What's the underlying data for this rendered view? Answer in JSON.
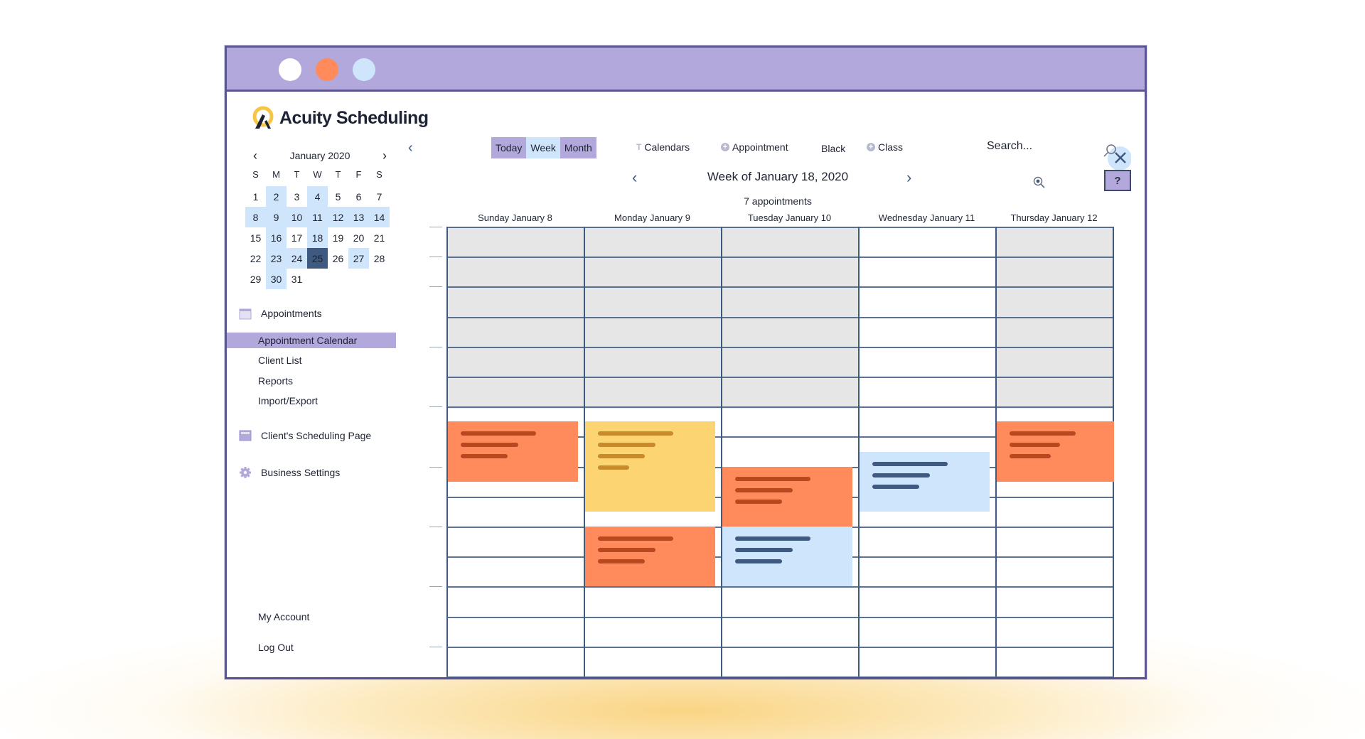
{
  "window": {
    "title_dots": [
      "white",
      "orange",
      "light-blue"
    ],
    "colors": {
      "titlebar": "#b2a8dc",
      "accent_orange": "#ff8a5b",
      "accent_yellow": "#fcd572",
      "accent_blue": "#cfe5fb",
      "selected_day": "#3e5a80"
    }
  },
  "brand": {
    "name": "Acuity Scheduling"
  },
  "mini_calendar": {
    "month_label": "January 2020",
    "weekdays": [
      "S",
      "M",
      "T",
      "W",
      "T",
      "F",
      "S"
    ],
    "weeks": [
      [
        1,
        2,
        3,
        4,
        5,
        6,
        7
      ],
      [
        8,
        9,
        10,
        11,
        12,
        13,
        14
      ],
      [
        15,
        16,
        17,
        18,
        19,
        20,
        21
      ],
      [
        22,
        23,
        24,
        25,
        26,
        27,
        28
      ],
      [
        29,
        30,
        31,
        null,
        null,
        null,
        null
      ]
    ],
    "highlighted_days": [
      2,
      4,
      8,
      9,
      10,
      11,
      12,
      13,
      14,
      16,
      18,
      23,
      24,
      27,
      30
    ],
    "selected_day": 25
  },
  "sidebar": {
    "appointments_label": "Appointments",
    "items": [
      {
        "label": "Appointment Calendar",
        "active": true
      },
      {
        "label": "Client List",
        "active": false
      },
      {
        "label": "Reports",
        "active": false
      },
      {
        "label": "Import/Export",
        "active": false
      }
    ],
    "scheduling_page_label": "Client's Scheduling Page",
    "business_settings_label": "Business Settings",
    "my_account_label": "My Account",
    "log_out_label": "Log Out"
  },
  "toolbar": {
    "today_label": "Today",
    "week_label": "Week",
    "month_label": "Month",
    "calendars_label": "Calendars",
    "appointment_label": "Appointment",
    "black_label": "Black",
    "class_label": "Class",
    "search_placeholder": "Search...",
    "help_label": "?"
  },
  "week_view": {
    "title": "Week of January 18, 2020",
    "appointment_count": "7 appointments",
    "days": [
      "Sunday January 8",
      "Monday January 9",
      "Tuesday January 10",
      "Wednesday January 11",
      "Thursday January 12"
    ],
    "appointments": [
      {
        "day": 0,
        "color": "orange",
        "start_slot": 6.5,
        "end_slot": 8.5,
        "lines": 3
      },
      {
        "day": 1,
        "color": "yellow",
        "start_slot": 6.5,
        "end_slot": 9.5,
        "lines": 4
      },
      {
        "day": 1,
        "color": "orange",
        "start_slot": 10.0,
        "end_slot": 12.0,
        "lines": 3
      },
      {
        "day": 2,
        "color": "orange",
        "start_slot": 8.0,
        "end_slot": 10.0,
        "lines": 3
      },
      {
        "day": 2,
        "color": "blue",
        "start_slot": 10.0,
        "end_slot": 12.0,
        "lines": 3
      },
      {
        "day": 3,
        "color": "blue",
        "start_slot": 7.5,
        "end_slot": 9.5,
        "lines": 3
      },
      {
        "day": 4,
        "color": "orange",
        "start_slot": 6.5,
        "end_slot": 8.5,
        "lines": 3
      }
    ],
    "unavailable_days": [
      0,
      1,
      2,
      4
    ]
  }
}
